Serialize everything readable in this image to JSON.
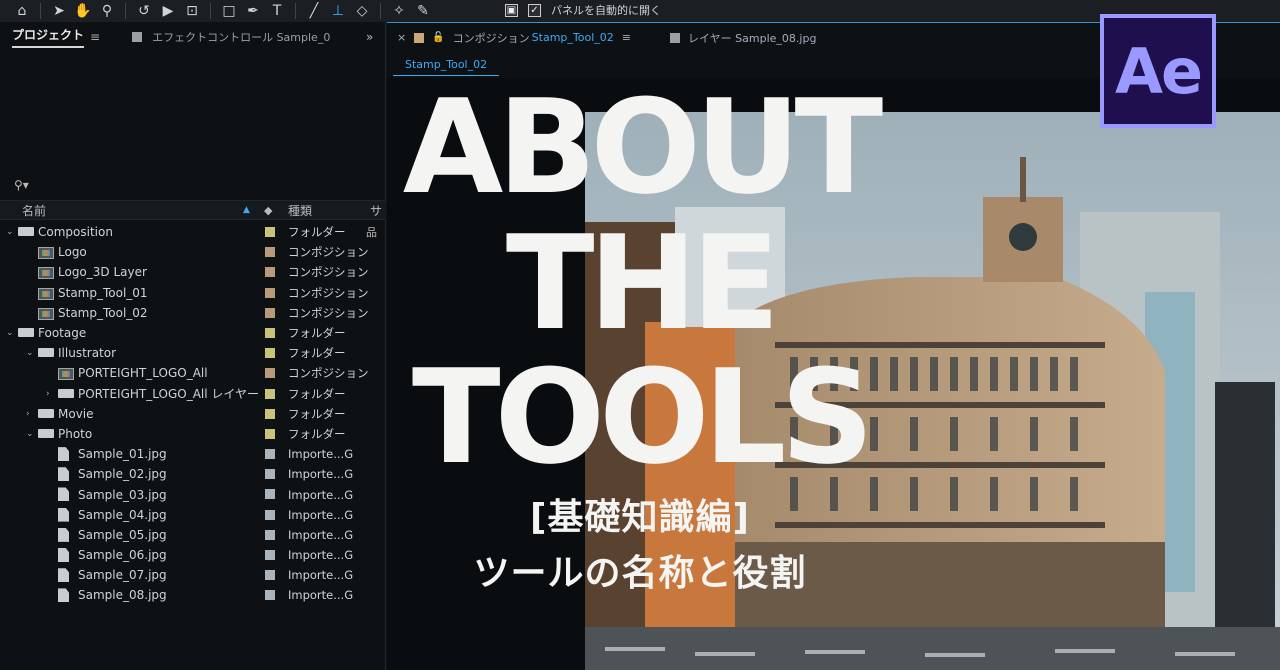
{
  "toolbar": {
    "tools": [
      "home-icon",
      "selection-arrow-icon",
      "hand-icon",
      "zoom-icon",
      "rotate-icon",
      "camera-icon",
      "pan-behind-icon",
      "rectangle-icon",
      "pen-icon",
      "type-icon",
      "brush-icon",
      "stamp-icon",
      "eraser-icon",
      "roto-brush-icon",
      "puppet-pin-icon"
    ],
    "auto_open_label": "パネルを自動的に開く"
  },
  "project_panel": {
    "tab_project": "プロジェクト",
    "tab_menu": "≡",
    "tab_effect": "エフェクトコントロール Sample_0",
    "more": "»",
    "search": "⚲▾",
    "columns": {
      "name": "名前",
      "sort": "▲",
      "type": "種類",
      "size": "サ"
    },
    "items": [
      {
        "name": "Composition",
        "type": "フォルダー",
        "level": 0,
        "kind": "folder",
        "open": true,
        "label": "#c8c27a",
        "extra": "品"
      },
      {
        "name": "Logo",
        "type": "コンポジション",
        "level": 1,
        "kind": "comp",
        "label": "#b89a7a"
      },
      {
        "name": "Logo_3D Layer",
        "type": "コンポジション",
        "level": 1,
        "kind": "comp",
        "label": "#b89a7a"
      },
      {
        "name": "Stamp_Tool_01",
        "type": "コンポジション",
        "level": 1,
        "kind": "comp",
        "label": "#b89a7a"
      },
      {
        "name": "Stamp_Tool_02",
        "type": "コンポジション",
        "level": 1,
        "kind": "comp",
        "label": "#b89a7a"
      },
      {
        "name": "Footage",
        "type": "フォルダー",
        "level": 0,
        "kind": "folder",
        "open": true,
        "label": "#c8c27a"
      },
      {
        "name": "Illustrator",
        "type": "フォルダー",
        "level": 1,
        "kind": "folder",
        "open": true,
        "label": "#c8c27a"
      },
      {
        "name": "PORTEIGHT_LOGO_All",
        "type": "コンポジション",
        "level": 2,
        "kind": "comp",
        "label": "#b89a7a"
      },
      {
        "name": "PORTEIGHT_LOGO_All レイヤー",
        "type": "フォルダー",
        "level": 2,
        "kind": "folder",
        "open": false,
        "label": "#c8c27a"
      },
      {
        "name": "Movie",
        "type": "フォルダー",
        "level": 1,
        "kind": "folder",
        "open": false,
        "label": "#c8c27a"
      },
      {
        "name": "Photo",
        "type": "フォルダー",
        "level": 1,
        "kind": "folder",
        "open": true,
        "label": "#c8c27a"
      },
      {
        "name": "Sample_01.jpg",
        "type": "Importe...G",
        "level": 2,
        "kind": "file",
        "label": "#aab4bc"
      },
      {
        "name": "Sample_02.jpg",
        "type": "Importe...G",
        "level": 2,
        "kind": "file",
        "label": "#aab4bc"
      },
      {
        "name": "Sample_03.jpg",
        "type": "Importe...G",
        "level": 2,
        "kind": "file",
        "label": "#aab4bc"
      },
      {
        "name": "Sample_04.jpg",
        "type": "Importe...G",
        "level": 2,
        "kind": "file",
        "label": "#aab4bc"
      },
      {
        "name": "Sample_05.jpg",
        "type": "Importe...G",
        "level": 2,
        "kind": "file",
        "label": "#aab4bc"
      },
      {
        "name": "Sample_06.jpg",
        "type": "Importe...G",
        "level": 2,
        "kind": "file",
        "label": "#aab4bc"
      },
      {
        "name": "Sample_07.jpg",
        "type": "Importe...G",
        "level": 2,
        "kind": "file",
        "label": "#aab4bc"
      },
      {
        "name": "Sample_08.jpg",
        "type": "Importe...G",
        "level": 2,
        "kind": "file",
        "label": "#aab4bc"
      }
    ]
  },
  "composition_panel": {
    "close": "×",
    "comp_tab_prefix": "コンポジション",
    "comp_tab_name": "Stamp_Tool_02",
    "comp_tab_menu": "≡",
    "layer_tab": "レイヤー Sample_08.jpg",
    "sub_tab": "Stamp_Tool_02",
    "lock": "🔓"
  },
  "overlay": {
    "title_line1": "ABOUT",
    "title_line2": "THE",
    "title_line3": "TOOLS",
    "subtitle_line1": "[基礎知識編]",
    "subtitle_line2": "ツールの名称と役割",
    "logo_text": "Ae"
  },
  "colors": {
    "accent_blue": "#3fa9f5",
    "ae_purple": "#9999ff",
    "ae_bg": "#1f0f4f"
  }
}
